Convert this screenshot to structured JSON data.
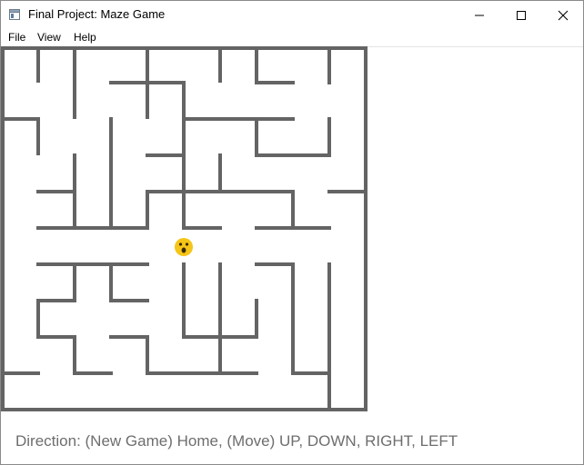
{
  "window": {
    "title": "Final Project: Maze Game",
    "app_icon": "window-app-icon",
    "controls": [
      "minimize-icon",
      "maximize-icon",
      "close-icon"
    ]
  },
  "menu": {
    "file": "File",
    "view": "View",
    "help": "Help"
  },
  "maze": {
    "wall_color": "#646464",
    "player_icon": "surprised-face-icon",
    "player_color": "#f5c518"
  },
  "status": {
    "text": "Direction: (New Game) Home, (Move) UP, DOWN, RIGHT, LEFT"
  }
}
